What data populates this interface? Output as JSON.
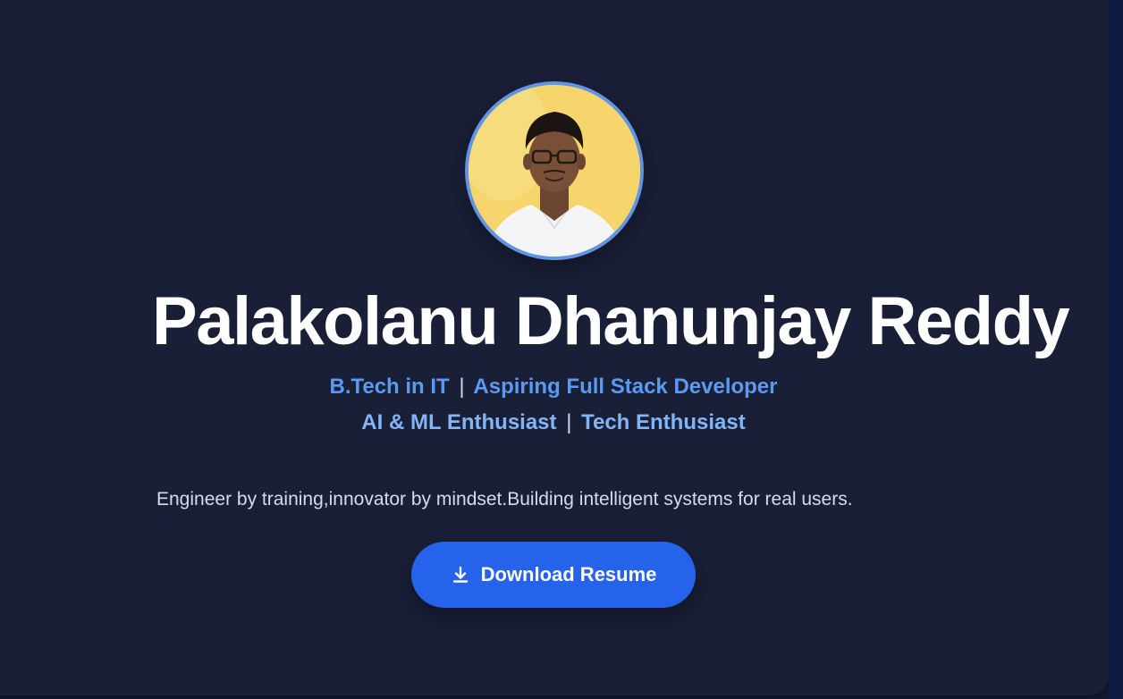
{
  "profile": {
    "name": "Palakolanu Dhanunjay Reddy",
    "avatar_alt": "profile photo",
    "tagline_line1": {
      "left": "B.Tech in IT",
      "separator": "|",
      "right": "Aspiring Full Stack Developer"
    },
    "tagline_line2": {
      "left": "AI & ML Enthusiast",
      "separator": "|",
      "right": "Tech Enthusiast"
    },
    "bio": "Engineer by training,innovator by mindset.Building intelligent systems for real users."
  },
  "actions": {
    "download_label": "Download Resume",
    "download_icon": "download-icon"
  },
  "colors": {
    "background": "#1a1f38",
    "accent": "#2563eb",
    "avatar_ring": "#5f95e2",
    "tagline_primary": "#5b9af0",
    "tagline_secondary": "#82b4f6"
  }
}
